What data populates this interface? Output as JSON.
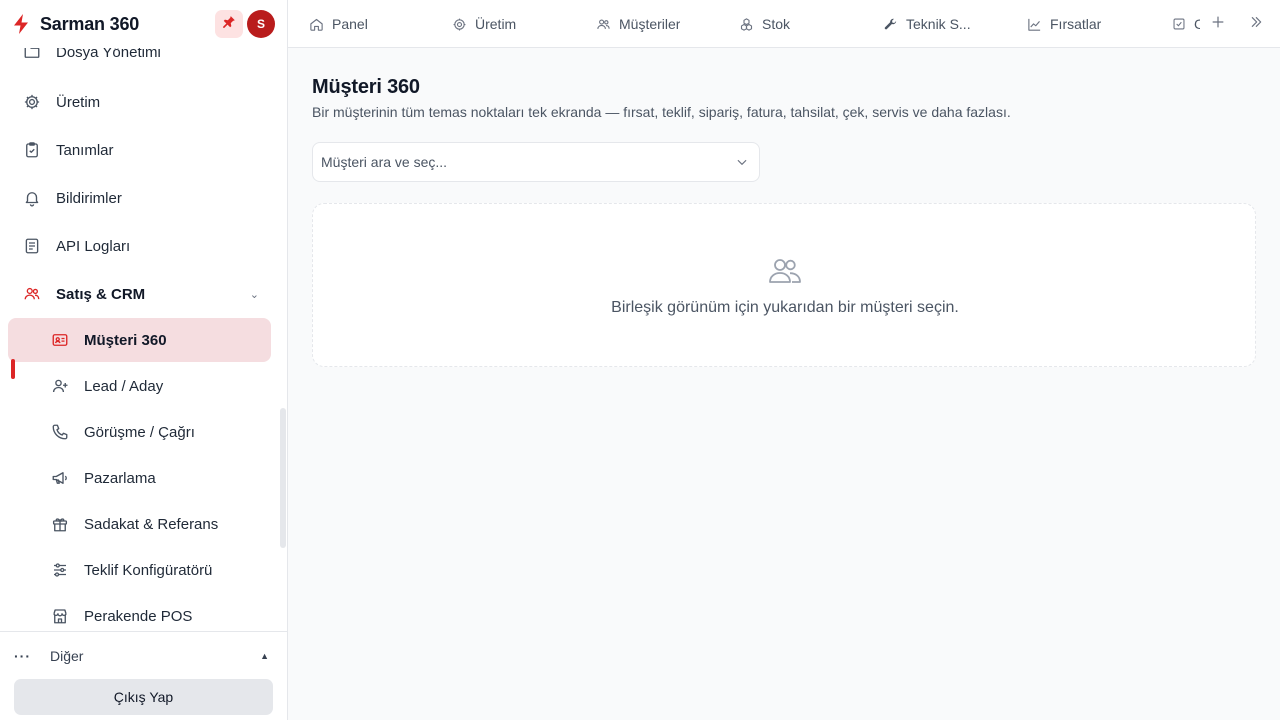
{
  "app": {
    "brand_name": "Sarman 360",
    "avatar_initial": "S",
    "accent_color": "#dc2626"
  },
  "sidebar": {
    "items": [
      {
        "label": "Dosya Yönetimi",
        "icon": "folder-icon"
      },
      {
        "label": "Üretim",
        "icon": "gear-icon"
      },
      {
        "label": "Tanımlar",
        "icon": "clipboard-icon"
      },
      {
        "label": "Bildirimler",
        "icon": "bell-icon"
      },
      {
        "label": "API Logları",
        "icon": "log-list-icon"
      }
    ],
    "group": {
      "label": "Satış & CRM",
      "icon": "users-icon",
      "expanded": true,
      "children": [
        {
          "label": "Müşteri 360",
          "icon": "id-card-icon",
          "active": true
        },
        {
          "label": "Lead / Aday",
          "icon": "user-plus-icon"
        },
        {
          "label": "Görüşme / Çağrı",
          "icon": "phone-icon"
        },
        {
          "label": "Pazarlama",
          "icon": "megaphone-icon"
        },
        {
          "label": "Sadakat & Referans",
          "icon": "gift-icon"
        },
        {
          "label": "Teklif Konfigüratörü",
          "icon": "sliders-icon"
        },
        {
          "label": "Perakende POS",
          "icon": "store-icon"
        }
      ]
    },
    "footer": {
      "more_label": "Diğer",
      "logout_label": "Çıkış Yap"
    }
  },
  "tabs": [
    {
      "label": "Panel",
      "icon": "home-icon"
    },
    {
      "label": "Üretim",
      "icon": "gear-icon"
    },
    {
      "label": "Müşteriler",
      "icon": "users-icon"
    },
    {
      "label": "Stok",
      "icon": "boxes-icon"
    },
    {
      "label": "Teknik S...",
      "icon": "wrench-icon"
    },
    {
      "label": "Fırsatlar",
      "icon": "trend-icon"
    },
    {
      "label": "C",
      "icon": "checkbox-icon"
    }
  ],
  "main": {
    "title": "Müşteri 360",
    "subtitle": "Bir müşterinin tüm temas noktaları tek ekranda — fırsat, teklif, sipariş, fatura, tahsilat, çek, servis ve daha fazlası.",
    "customer_select_placeholder": "Müşteri ara ve seç...",
    "empty_message": "Birleşik görünüm için yukarıdan bir müşteri seçin."
  }
}
